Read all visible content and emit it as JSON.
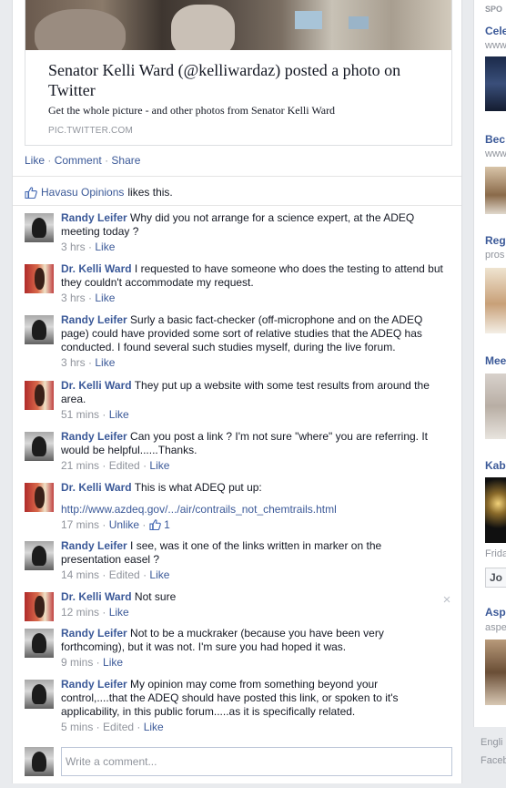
{
  "share": {
    "title": "Senator Kelli Ward (@kelliwardaz) posted a photo on Twitter",
    "description": "Get the whole picture - and other photos from Senator Kelli Ward",
    "domain": "PIC.TWITTER.COM"
  },
  "actions": {
    "like": "Like",
    "comment": "Comment",
    "share": "Share",
    "sep": "·"
  },
  "likes": {
    "page": "Havasu Opinions",
    "text": "likes this."
  },
  "comments": [
    {
      "author": "Randy Leifer",
      "avatar": "randy",
      "text": "Why did you not arrange for a science expert, at the ADEQ meeting today ?",
      "time": "3 hrs",
      "edited": "",
      "action": "Like"
    },
    {
      "author": "Dr. Kelli Ward",
      "avatar": "kelli",
      "text": "I requested to have someone who does the testing to attend but they couldn't accommodate my request.",
      "time": "3 hrs",
      "edited": "",
      "action": "Like"
    },
    {
      "author": "Randy Leifer",
      "avatar": "randy",
      "text": "Surly a basic fact-checker (off-microphone and on the ADEQ page) could have provided some sort of relative studies that the ADEQ has conducted. I found several such studies myself, during the live forum.",
      "time": "3 hrs",
      "edited": "",
      "action": "Like"
    },
    {
      "author": "Dr. Kelli Ward",
      "avatar": "kelli",
      "text": "They put up a website with some test results from around the area.",
      "time": "51 mins",
      "edited": "",
      "action": "Like"
    },
    {
      "author": "Randy Leifer",
      "avatar": "randy",
      "text": "Can you post a link ? I'm not sure \"where\" you are referring. It would be helpful......Thanks.",
      "time": "21 mins",
      "edited": "Edited",
      "action": "Like"
    },
    {
      "author": "Dr. Kelli Ward",
      "avatar": "kelli",
      "text": "This is what ADEQ put up:",
      "url": "http://www.azdeq.gov/.../air/contrails_not_chemtrails.html",
      "time": "17 mins",
      "edited": "",
      "action": "Unlike",
      "like_count": "1"
    },
    {
      "author": "Randy Leifer",
      "avatar": "randy",
      "text": "I see, was it one of the links written in marker on the presentation easel ?",
      "time": "14 mins",
      "edited": "Edited",
      "action": "Like"
    },
    {
      "author": "Dr. Kelli Ward",
      "avatar": "kelli",
      "text": "Not sure",
      "time": "12 mins",
      "edited": "",
      "action": "Like"
    },
    {
      "author": "Randy Leifer",
      "avatar": "randy",
      "text": "Not to be a muckraker (because you have been very forthcoming), but it was not. I'm sure you had hoped it was.",
      "time": "9 mins",
      "edited": "",
      "action": "Like"
    },
    {
      "author": "Randy Leifer",
      "avatar": "randy",
      "text": "My opinion may come from something beyond your control,....that the ADEQ should have posted this link, or spoken to it's applicability, in this public forum.....as it is specifically related.",
      "time": "5 mins",
      "edited": "Edited",
      "action": "Like"
    }
  ],
  "composer": {
    "placeholder": "Write a comment..."
  },
  "sidebar": {
    "header": "SPO",
    "ads": [
      {
        "title": "Cele",
        "sub": "www"
      },
      {
        "title": "Bec",
        "sub": "www"
      },
      {
        "title": "Reg",
        "sub": "pros"
      },
      {
        "title": "Mee",
        "sub": ""
      },
      {
        "title": "Kab",
        "sub": "Frida",
        "button": "Jo"
      },
      {
        "title": "Asp",
        "sub": "aspe"
      }
    ],
    "footer": [
      "Engli",
      "Faceb"
    ]
  },
  "colors": {
    "link": "#3b5998",
    "meta": "#90949c",
    "page_bg": "#e9ebee"
  },
  "icons": [
    "thumb-up-icon",
    "close-icon"
  ]
}
